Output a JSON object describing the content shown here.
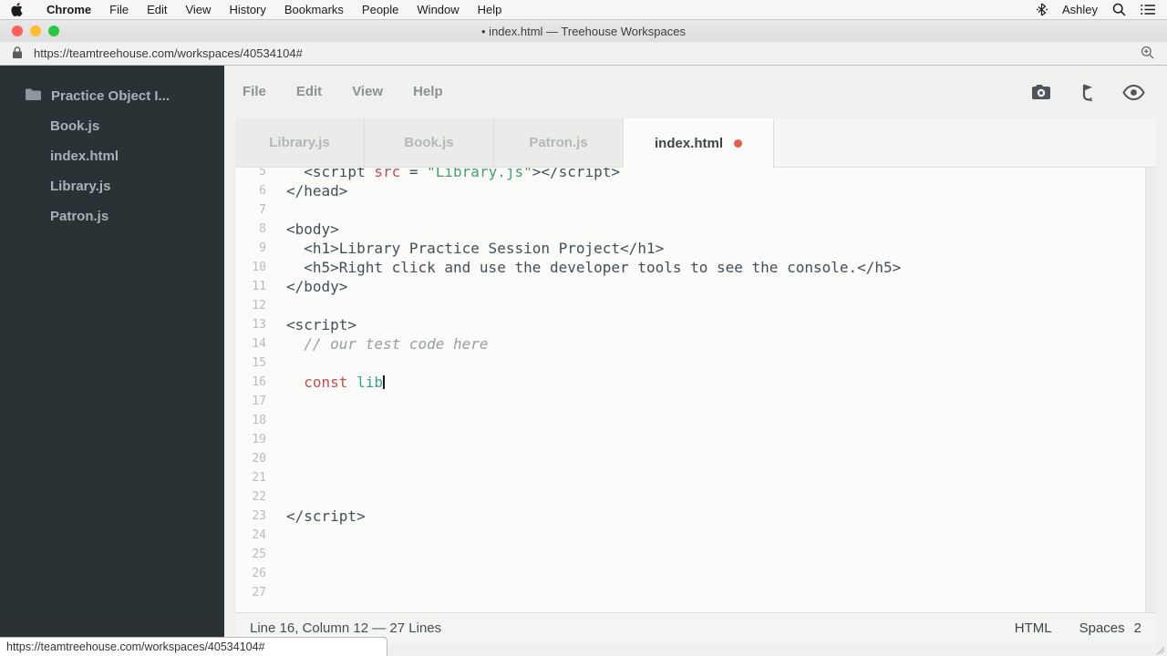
{
  "colors": {
    "traffic_red": "#ff5f57",
    "traffic_yellow": "#febc2e",
    "traffic_green": "#28c840",
    "unsaved_dot": "#e4604e",
    "sidebar_bg": "#2b3235",
    "syntax_tag": "#414f58",
    "syntax_attr": "#cf4a50",
    "syntax_string": "#3fa272",
    "syntax_keyword": "#cf4a50",
    "syntax_variable": "#35a18b",
    "syntax_comment": "#949da1"
  },
  "menubar": {
    "app_name": "Chrome",
    "items": [
      "File",
      "Edit",
      "View",
      "History",
      "Bookmarks",
      "People",
      "Window",
      "Help"
    ],
    "user_name": "Ashley",
    "icons": [
      "bluetooth-icon",
      "search-icon",
      "list-icon"
    ]
  },
  "browser": {
    "window_title": "• index.html — Treehouse Workspaces",
    "url": "https://teamtreehouse.com/workspaces/40534104#"
  },
  "sidebar": {
    "project_name": "Practice Object I...",
    "files": [
      "Book.js",
      "index.html",
      "Library.js",
      "Patron.js"
    ]
  },
  "editor": {
    "menu_items": [
      "File",
      "Edit",
      "View",
      "Help"
    ],
    "tabs": [
      {
        "label": "Library.js",
        "active": false,
        "modified": false
      },
      {
        "label": "Book.js",
        "active": false,
        "modified": false
      },
      {
        "label": "Patron.js",
        "active": false,
        "modified": false
      },
      {
        "label": "index.html",
        "active": true,
        "modified": true
      }
    ],
    "code_lines": [
      {
        "n": 5,
        "s": [
          {
            "t": "  <script ",
            "c": "tag"
          },
          {
            "t": "src",
            "c": "attr"
          },
          {
            "t": " = ",
            "c": "tag"
          },
          {
            "t": "\"Library.js\"",
            "c": "str"
          },
          {
            "t": "></script>",
            "c": "tag"
          }
        ]
      },
      {
        "n": 6,
        "s": [
          {
            "t": "</head>",
            "c": "tag"
          }
        ]
      },
      {
        "n": 7,
        "s": []
      },
      {
        "n": 8,
        "s": [
          {
            "t": "<body>",
            "c": "tag"
          }
        ]
      },
      {
        "n": 9,
        "s": [
          {
            "t": "  <h1>Library Practice Session Project</h1>",
            "c": "tag"
          }
        ]
      },
      {
        "n": 10,
        "s": [
          {
            "t": "  <h5>Right click and use the developer tools to see the console.</h5>",
            "c": "tag"
          }
        ]
      },
      {
        "n": 11,
        "s": [
          {
            "t": "</body>",
            "c": "tag"
          }
        ]
      },
      {
        "n": 12,
        "s": []
      },
      {
        "n": 13,
        "s": [
          {
            "t": "<script>",
            "c": "tag"
          }
        ]
      },
      {
        "n": 14,
        "s": [
          {
            "t": "  // our test code here",
            "c": "cmt"
          }
        ]
      },
      {
        "n": 15,
        "s": []
      },
      {
        "n": 16,
        "s": [
          {
            "t": "  ",
            "c": "tag"
          },
          {
            "t": "const",
            "c": "kw"
          },
          {
            "t": " ",
            "c": "tag"
          },
          {
            "t": "lib",
            "c": "var"
          }
        ],
        "caret": true
      },
      {
        "n": 17,
        "s": []
      },
      {
        "n": 18,
        "s": []
      },
      {
        "n": 19,
        "s": []
      },
      {
        "n": 20,
        "s": []
      },
      {
        "n": 21,
        "s": []
      },
      {
        "n": 22,
        "s": []
      },
      {
        "n": 23,
        "s": [
          {
            "t": "</script>",
            "c": "tag"
          }
        ]
      },
      {
        "n": 24,
        "s": []
      },
      {
        "n": 25,
        "s": []
      },
      {
        "n": 26,
        "s": []
      },
      {
        "n": 27,
        "s": []
      }
    ],
    "statusbar": {
      "position_text": "Line 16, Column 12 — 27 Lines",
      "mode": "HTML",
      "indent_label": "Spaces",
      "indent_value": "2"
    }
  },
  "link_preview": "https://teamtreehouse.com/workspaces/40534104#"
}
